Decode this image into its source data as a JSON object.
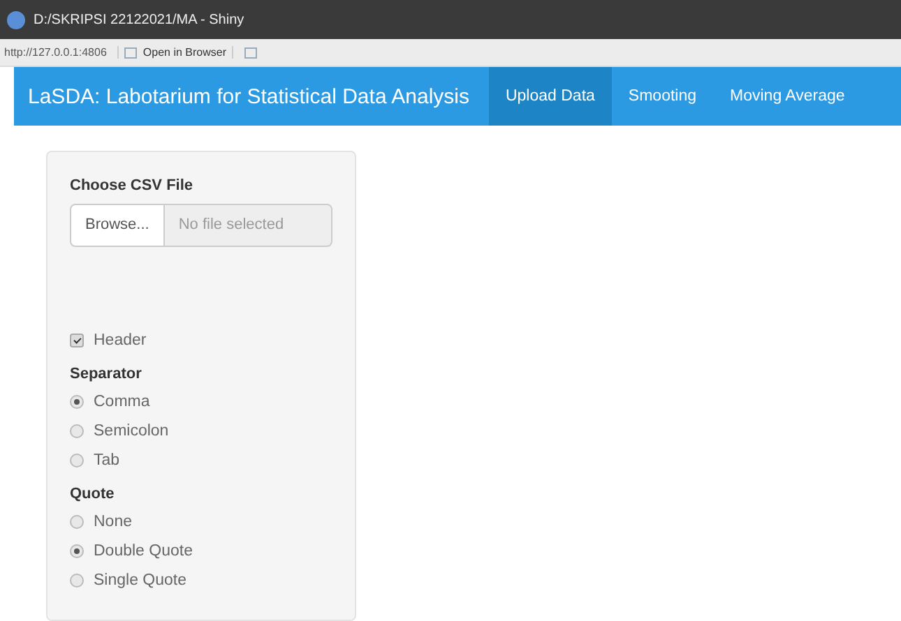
{
  "window": {
    "title": "D:/SKRIPSI 22122021/MA - Shiny"
  },
  "address_bar": {
    "url": "http://127.0.0.1:4806",
    "open_button": "Open in Browser"
  },
  "navbar": {
    "brand": "LaSDA: Labotarium for Statistical Data Analysis",
    "tabs": [
      {
        "label": "Upload Data",
        "selected": true
      },
      {
        "label": "Smooting",
        "selected": false
      },
      {
        "label": "Moving Average",
        "selected": false
      }
    ]
  },
  "sidebar": {
    "file_label": "Choose CSV File",
    "browse": "Browse...",
    "file_placeholder": "No file selected",
    "header": {
      "label": "Header",
      "checked": true
    },
    "groups": [
      {
        "title": "Separator",
        "options": [
          {
            "label": "Comma",
            "selected": true
          },
          {
            "label": "Semicolon",
            "selected": false
          },
          {
            "label": "Tab",
            "selected": false
          }
        ]
      },
      {
        "title": "Quote",
        "options": [
          {
            "label": "None",
            "selected": false
          },
          {
            "label": "Double Quote",
            "selected": true
          },
          {
            "label": "Single Quote",
            "selected": false
          }
        ]
      }
    ]
  }
}
